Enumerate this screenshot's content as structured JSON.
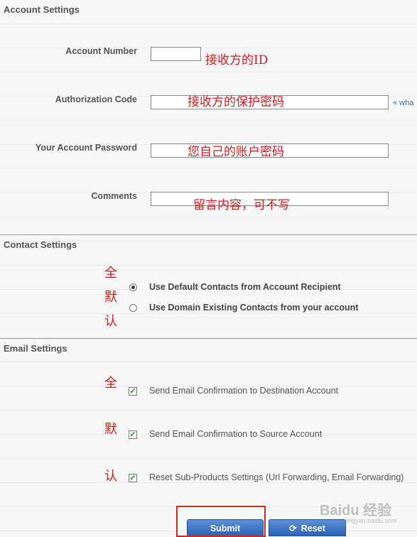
{
  "account_settings": {
    "title": "Account Settings",
    "fields": [
      {
        "label": "Account Number",
        "value": "",
        "note": "接收方的ID"
      },
      {
        "label": "Authorization Code",
        "value": "",
        "note": "接收方的保护密码",
        "help_link": "« wha"
      },
      {
        "label": "Your Account Password",
        "value": "",
        "note": "您自己的账户密码"
      },
      {
        "label": "Comments",
        "value": "",
        "note": "留言内容，可不写"
      }
    ]
  },
  "contact_settings": {
    "title": "Contact Settings",
    "annotation": [
      "全",
      "默",
      "认"
    ],
    "options": [
      {
        "label": "Use Default Contacts from Account Recipient",
        "selected": true
      },
      {
        "label": "Use Domain Existing Contacts from your account",
        "selected": false
      }
    ]
  },
  "email_settings": {
    "title": "Email Settings",
    "annotation": [
      "全",
      "默",
      "认"
    ],
    "options": [
      {
        "label": "Send Email Confirmation to Destination Account",
        "checked": true
      },
      {
        "label": "Send Email Confirmation to Source Account",
        "checked": true
      },
      {
        "label": "Reset Sub-Products Settings (Url Forwarding, Email Forwarding)",
        "checked": true
      }
    ]
  },
  "buttons": {
    "submit_label": "Submit",
    "reset_label": "Reset"
  },
  "watermark": {
    "main": "Baidu 经验",
    "sub": "jingyan.baidu.com"
  },
  "colors": {
    "annotation_red": "#d21e1e",
    "button_blue": "#2e62b7",
    "check_green": "#1c8f23"
  },
  "icons": {
    "reset": "refresh-icon",
    "checkbox": "checkmark-icon"
  }
}
